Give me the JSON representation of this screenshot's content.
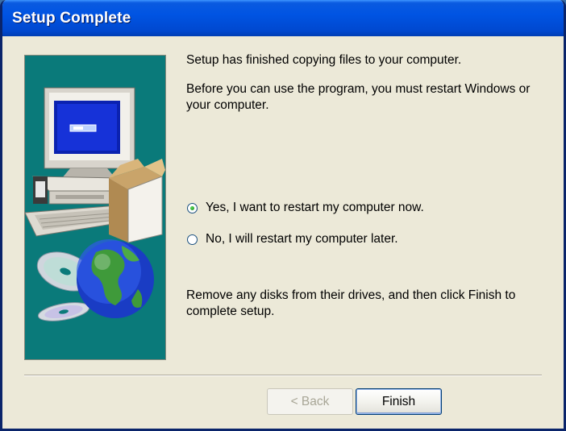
{
  "window": {
    "title": "Setup Complete"
  },
  "content": {
    "line1": "Setup has finished copying files to your computer.",
    "line2": "Before you can use the program, you must restart Windows or your computer.",
    "footer_text": "Remove any disks from their drives, and then click Finish to complete setup."
  },
  "options": [
    {
      "label": "Yes, I want to restart my computer now.",
      "selected": true
    },
    {
      "label": "No, I will restart my computer later.",
      "selected": false
    }
  ],
  "buttons": {
    "back_label": "< Back",
    "back_enabled": false,
    "finish_label": "Finish"
  },
  "colors": {
    "titlebar": "#0054e3",
    "panel_background": "#0a7a7a",
    "dialog_background": "#ece9d8"
  },
  "illustration": {
    "icons": [
      "computer-icon",
      "cd-icon",
      "globe-icon",
      "software-box-icon"
    ]
  }
}
